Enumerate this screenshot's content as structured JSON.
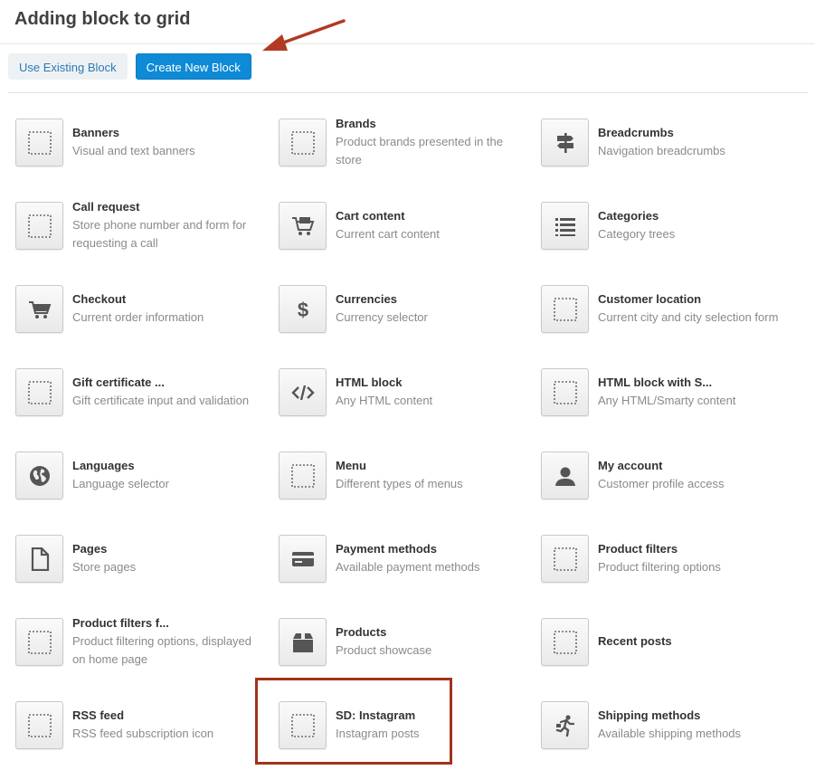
{
  "dialog": {
    "title": "Adding block to grid"
  },
  "tabs": {
    "use_existing": "Use Existing Block",
    "create_new": "Create New Block"
  },
  "colors": {
    "accent": "#0e8ad6",
    "highlight": "#a2321c",
    "arrow": "#b23a22"
  },
  "blocks": [
    {
      "name": "Banners",
      "desc": "Visual and text banners",
      "icon": "placeholder-icon"
    },
    {
      "name": "Brands",
      "desc": "Product brands presented in the store",
      "icon": "placeholder-icon"
    },
    {
      "name": "Breadcrumbs",
      "desc": "Navigation breadcrumbs",
      "icon": "signpost-icon"
    },
    {
      "name": "Call request",
      "desc": "Store phone number and form for requesting a call",
      "icon": "placeholder-icon"
    },
    {
      "name": "Cart content",
      "desc": "Current cart content",
      "icon": "cart-full-icon"
    },
    {
      "name": "Categories",
      "desc": "Category trees",
      "icon": "list-icon"
    },
    {
      "name": "Checkout",
      "desc": "Current order information",
      "icon": "cart-icon"
    },
    {
      "name": "Currencies",
      "desc": "Currency selector",
      "icon": "dollar-icon"
    },
    {
      "name": "Customer location",
      "desc": "Current city and city selection form",
      "icon": "placeholder-icon"
    },
    {
      "name": "Gift certificate ...",
      "desc": "Gift certificate input and validation",
      "icon": "placeholder-icon"
    },
    {
      "name": "HTML block",
      "desc": "Any HTML content",
      "icon": "code-icon"
    },
    {
      "name": "HTML block with S...",
      "desc": "Any HTML/Smarty content",
      "icon": "placeholder-icon"
    },
    {
      "name": "Languages",
      "desc": "Language selector",
      "icon": "globe-icon"
    },
    {
      "name": "Menu",
      "desc": "Different types of menus",
      "icon": "placeholder-icon"
    },
    {
      "name": "My account",
      "desc": "Customer profile access",
      "icon": "user-icon"
    },
    {
      "name": "Pages",
      "desc": "Store pages",
      "icon": "page-icon"
    },
    {
      "name": "Payment methods",
      "desc": "Available payment methods",
      "icon": "credit-card-icon"
    },
    {
      "name": "Product filters",
      "desc": "Product filtering options",
      "icon": "placeholder-icon"
    },
    {
      "name": "Product filters f...",
      "desc": "Product filtering options, displayed on home page",
      "icon": "placeholder-icon"
    },
    {
      "name": "Products",
      "desc": "Product showcase",
      "icon": "box-icon"
    },
    {
      "name": "Recent posts",
      "desc": "",
      "icon": "placeholder-icon"
    },
    {
      "name": "RSS feed",
      "desc": "RSS feed subscription icon",
      "icon": "placeholder-icon"
    },
    {
      "name": "SD: Instagram",
      "desc": "Instagram posts",
      "icon": "placeholder-icon"
    },
    {
      "name": "Shipping methods",
      "desc": "Available shipping methods",
      "icon": "runner-icon"
    }
  ]
}
